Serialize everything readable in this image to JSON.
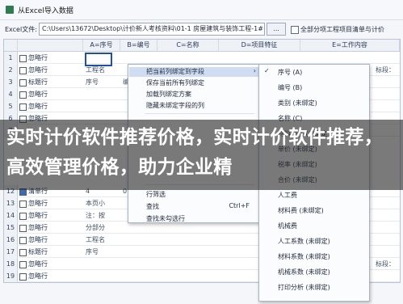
{
  "window": {
    "title": "从Excel导入数据"
  },
  "toolbar": {
    "file_label": "Excel文件:",
    "file_path": "C:\\Users\\13672\\Desktop\\计价新人考核资料\\01-1 房屋建筑与装饰工程-1#~2#房.xls",
    "browse_label": "...",
    "option_label": "全部分项工程项目清单与计价"
  },
  "grid": {
    "columns": [
      "A=序号",
      "B=编号",
      "C=名称",
      "D=项目特征",
      "E=工作内容"
    ],
    "rows": [
      {
        "num": "1",
        "checked": false,
        "kind": "忽略行",
        "a": "",
        "b": ""
      },
      {
        "num": "2",
        "checked": false,
        "kind": "忽略行",
        "a": "工程名",
        "b": ""
      },
      {
        "num": "3",
        "checked": false,
        "kind": "标题行",
        "a": "序号",
        "b": "编"
      },
      {
        "num": "4",
        "checked": false,
        "kind": "忽略行",
        "a": "",
        "b": ""
      },
      {
        "num": "5",
        "checked": false,
        "kind": "忽略行",
        "a": "",
        "b": ""
      },
      {
        "num": "6",
        "checked": false,
        "kind": "忽略行",
        "a": "",
        "b": ""
      },
      {
        "num": "7",
        "checked": false,
        "kind": "",
        "a": "",
        "b": ""
      },
      {
        "num": "12",
        "checked": true,
        "kind": "清单行",
        "a": "4",
        "b": "01030"
      },
      {
        "num": "13",
        "checked": false,
        "kind": "忽略行",
        "a": "本页小",
        "b": ""
      },
      {
        "num": "14",
        "checked": false,
        "kind": "忽略行",
        "a": "注：按",
        "b": ""
      },
      {
        "num": "15",
        "checked": false,
        "kind": "忽略行",
        "a": "分部分",
        "b": ""
      },
      {
        "num": "16",
        "checked": false,
        "kind": "忽略行",
        "a": "工程名",
        "b": ""
      },
      {
        "num": "17",
        "checked": false,
        "kind": "标题行",
        "a": "序号",
        "b": ""
      },
      {
        "num": "18",
        "checked": false,
        "kind": "忽略行",
        "a": "",
        "b": ""
      },
      {
        "num": "19",
        "checked": false,
        "kind": "忽略行",
        "a": "",
        "b": ""
      }
    ],
    "right_col_text": "标段："
  },
  "context_menu": {
    "items": [
      {
        "label": "把当前列绑定到字段",
        "shortcut": "",
        "arrow": true,
        "highlighted": true
      },
      {
        "label": "保存当前所有列绑定",
        "shortcut": "",
        "arrow": false,
        "highlighted": false
      },
      {
        "label": "加载列绑定方案",
        "shortcut": "",
        "arrow": false,
        "highlighted": false
      },
      {
        "label": "隐藏未绑定字段的列",
        "shortcut": "",
        "arrow": false,
        "highlighted": false
      },
      {
        "label": "行筛选",
        "shortcut": "",
        "arrow": false,
        "highlighted": false
      },
      {
        "label": "查找",
        "shortcut": "Ctrl+F",
        "arrow": false,
        "highlighted": false
      },
      {
        "label": "查找未勾选行",
        "shortcut": "",
        "arrow": false,
        "highlighted": false
      }
    ]
  },
  "submenu": {
    "items": [
      {
        "label": "序号 (A)",
        "checked": true
      },
      {
        "label": "编号 (B)",
        "checked": false
      },
      {
        "label": "类别 (未绑定)",
        "checked": false
      },
      {
        "label": "名称 (C)",
        "checked": false
      },
      {
        "label": "材料规格 (未绑定)",
        "checked": false
      },
      {
        "label": "单价 (未绑定)",
        "checked": false
      },
      {
        "label": "税率 (未绑定)",
        "checked": false
      },
      {
        "label": "合价 (未绑定)",
        "checked": false
      },
      {
        "label": "人工费",
        "checked": false
      },
      {
        "label": "材料费 (未绑定)",
        "checked": false
      },
      {
        "label": "机械费",
        "checked": false
      },
      {
        "label": "人工系数 (未绑定)",
        "checked": false
      },
      {
        "label": "材料系数 (未绑定)",
        "checked": false
      },
      {
        "label": "机械系数 (未绑定)",
        "checked": false
      },
      {
        "label": "打印分析 (未绑定)",
        "checked": false
      }
    ]
  },
  "banner": {
    "text": "实时计价软件推荐价格，实时计价软件推荐，高效管理价格，助力企业精"
  },
  "colors": {
    "accent": "#1f4fa8",
    "highlight": "#cfdcf2",
    "banner": "#3a3a3a"
  },
  "icons": {
    "app": "excel-icon",
    "check": "checkmark-icon",
    "arrow": "chevron-right-icon"
  }
}
